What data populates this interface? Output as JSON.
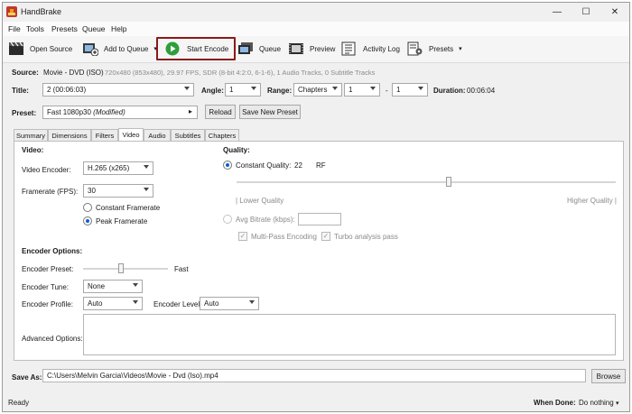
{
  "window": {
    "title": "HandBrake",
    "min": "—",
    "max": "☐",
    "close": "✕"
  },
  "menu": [
    "File",
    "Tools",
    "Presets",
    "Queue",
    "Help"
  ],
  "toolbar": {
    "open_source": "Open Source",
    "add_to_queue": "Add to Queue",
    "start_encode": "Start Encode",
    "queue": "Queue",
    "preview": "Preview",
    "activity_log": "Activity Log",
    "presets": "Presets"
  },
  "source": {
    "label": "Source:",
    "value": "Movie - DVD (ISO)",
    "details": "720x480 (853x480), 29.97 FPS, SDR (8-bit 4:2:0, 6-1-6), 1 Audio Tracks, 0 Subtitle Tracks"
  },
  "title_row": {
    "title_label": "Title:",
    "title_value": "2  (00:06:03)",
    "angle_label": "Angle:",
    "angle_value": "1",
    "range_label": "Range:",
    "range_value": "Chapters",
    "range_from": "1",
    "dash": "-",
    "range_to": "1",
    "duration_label": "Duration:",
    "duration_value": "00:06:04"
  },
  "preset": {
    "label": "Preset:",
    "name": "Fast 1080p30",
    "modified": "(Modified)",
    "reload": "Reload",
    "save_new": "Save New Preset"
  },
  "tabs": [
    "Summary",
    "Dimensions",
    "Filters",
    "Video",
    "Audio",
    "Subtitles",
    "Chapters"
  ],
  "active_tab": "Video",
  "video": {
    "heading": "Video:",
    "encoder_label": "Video Encoder:",
    "encoder_value": "H.265 (x265)",
    "framerate_label": "Framerate (FPS):",
    "framerate_value": "30",
    "constant_framerate": "Constant Framerate",
    "peak_framerate": "Peak Framerate"
  },
  "quality": {
    "heading": "Quality:",
    "constant_quality_label": "Constant Quality:",
    "cq_value": "22",
    "cq_unit": "RF",
    "cq_position": 0.56,
    "lower": "| Lower Quality",
    "higher": "Higher Quality |",
    "avg_bitrate_label": "Avg Bitrate (kbps):",
    "multipass": "Multi-Pass Encoding",
    "turbo": "Turbo analysis pass"
  },
  "encoder_options": {
    "heading": "Encoder Options:",
    "preset_label": "Encoder Preset:",
    "preset_value": "Fast",
    "preset_position": 0.45,
    "tune_label": "Encoder Tune:",
    "tune_value": "None",
    "profile_label": "Encoder Profile:",
    "profile_value": "Auto",
    "level_label": "Encoder Level:",
    "level_value": "Auto",
    "advanced_label": "Advanced Options:"
  },
  "save_as": {
    "label": "Save As:",
    "path": "C:\\Users\\Melvin Garcia\\Videos\\Movie - Dvd (Iso).mp4",
    "browse": "Browse"
  },
  "status": {
    "ready": "Ready",
    "when_done_label": "When Done:",
    "when_done_value": "Do nothing"
  },
  "colors": {
    "highlight": "#8b1a1a",
    "radio_accent": "#0a5fd6",
    "play_green": "#2e9e3a"
  }
}
